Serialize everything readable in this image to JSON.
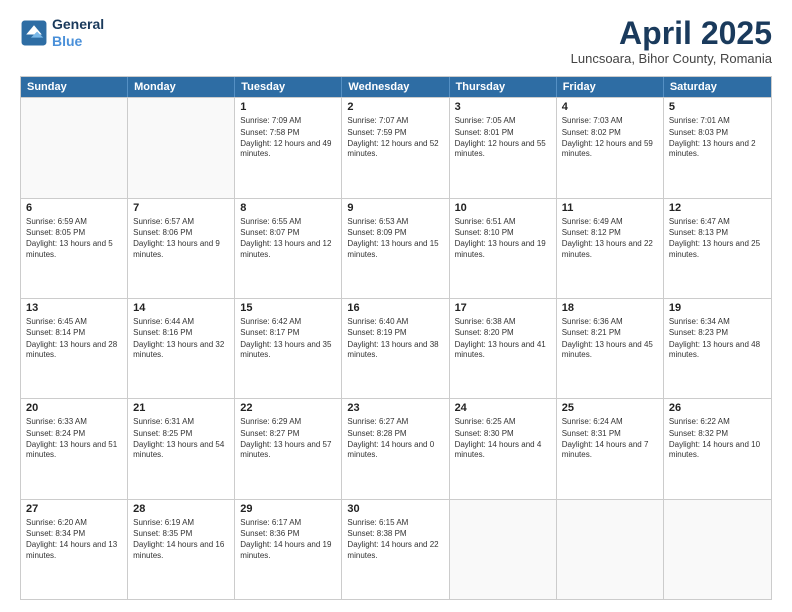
{
  "header": {
    "logo_line1": "General",
    "logo_line2": "Blue",
    "main_title": "April 2025",
    "subtitle": "Luncsoara, Bihor County, Romania"
  },
  "calendar": {
    "day_headers": [
      "Sunday",
      "Monday",
      "Tuesday",
      "Wednesday",
      "Thursday",
      "Friday",
      "Saturday"
    ],
    "rows": [
      [
        {
          "day": "",
          "sunrise": "",
          "sunset": "",
          "daylight": ""
        },
        {
          "day": "",
          "sunrise": "",
          "sunset": "",
          "daylight": ""
        },
        {
          "day": "1",
          "sunrise": "Sunrise: 7:09 AM",
          "sunset": "Sunset: 7:58 PM",
          "daylight": "Daylight: 12 hours and 49 minutes."
        },
        {
          "day": "2",
          "sunrise": "Sunrise: 7:07 AM",
          "sunset": "Sunset: 7:59 PM",
          "daylight": "Daylight: 12 hours and 52 minutes."
        },
        {
          "day": "3",
          "sunrise": "Sunrise: 7:05 AM",
          "sunset": "Sunset: 8:01 PM",
          "daylight": "Daylight: 12 hours and 55 minutes."
        },
        {
          "day": "4",
          "sunrise": "Sunrise: 7:03 AM",
          "sunset": "Sunset: 8:02 PM",
          "daylight": "Daylight: 12 hours and 59 minutes."
        },
        {
          "day": "5",
          "sunrise": "Sunrise: 7:01 AM",
          "sunset": "Sunset: 8:03 PM",
          "daylight": "Daylight: 13 hours and 2 minutes."
        }
      ],
      [
        {
          "day": "6",
          "sunrise": "Sunrise: 6:59 AM",
          "sunset": "Sunset: 8:05 PM",
          "daylight": "Daylight: 13 hours and 5 minutes."
        },
        {
          "day": "7",
          "sunrise": "Sunrise: 6:57 AM",
          "sunset": "Sunset: 8:06 PM",
          "daylight": "Daylight: 13 hours and 9 minutes."
        },
        {
          "day": "8",
          "sunrise": "Sunrise: 6:55 AM",
          "sunset": "Sunset: 8:07 PM",
          "daylight": "Daylight: 13 hours and 12 minutes."
        },
        {
          "day": "9",
          "sunrise": "Sunrise: 6:53 AM",
          "sunset": "Sunset: 8:09 PM",
          "daylight": "Daylight: 13 hours and 15 minutes."
        },
        {
          "day": "10",
          "sunrise": "Sunrise: 6:51 AM",
          "sunset": "Sunset: 8:10 PM",
          "daylight": "Daylight: 13 hours and 19 minutes."
        },
        {
          "day": "11",
          "sunrise": "Sunrise: 6:49 AM",
          "sunset": "Sunset: 8:12 PM",
          "daylight": "Daylight: 13 hours and 22 minutes."
        },
        {
          "day": "12",
          "sunrise": "Sunrise: 6:47 AM",
          "sunset": "Sunset: 8:13 PM",
          "daylight": "Daylight: 13 hours and 25 minutes."
        }
      ],
      [
        {
          "day": "13",
          "sunrise": "Sunrise: 6:45 AM",
          "sunset": "Sunset: 8:14 PM",
          "daylight": "Daylight: 13 hours and 28 minutes."
        },
        {
          "day": "14",
          "sunrise": "Sunrise: 6:44 AM",
          "sunset": "Sunset: 8:16 PM",
          "daylight": "Daylight: 13 hours and 32 minutes."
        },
        {
          "day": "15",
          "sunrise": "Sunrise: 6:42 AM",
          "sunset": "Sunset: 8:17 PM",
          "daylight": "Daylight: 13 hours and 35 minutes."
        },
        {
          "day": "16",
          "sunrise": "Sunrise: 6:40 AM",
          "sunset": "Sunset: 8:19 PM",
          "daylight": "Daylight: 13 hours and 38 minutes."
        },
        {
          "day": "17",
          "sunrise": "Sunrise: 6:38 AM",
          "sunset": "Sunset: 8:20 PM",
          "daylight": "Daylight: 13 hours and 41 minutes."
        },
        {
          "day": "18",
          "sunrise": "Sunrise: 6:36 AM",
          "sunset": "Sunset: 8:21 PM",
          "daylight": "Daylight: 13 hours and 45 minutes."
        },
        {
          "day": "19",
          "sunrise": "Sunrise: 6:34 AM",
          "sunset": "Sunset: 8:23 PM",
          "daylight": "Daylight: 13 hours and 48 minutes."
        }
      ],
      [
        {
          "day": "20",
          "sunrise": "Sunrise: 6:33 AM",
          "sunset": "Sunset: 8:24 PM",
          "daylight": "Daylight: 13 hours and 51 minutes."
        },
        {
          "day": "21",
          "sunrise": "Sunrise: 6:31 AM",
          "sunset": "Sunset: 8:25 PM",
          "daylight": "Daylight: 13 hours and 54 minutes."
        },
        {
          "day": "22",
          "sunrise": "Sunrise: 6:29 AM",
          "sunset": "Sunset: 8:27 PM",
          "daylight": "Daylight: 13 hours and 57 minutes."
        },
        {
          "day": "23",
          "sunrise": "Sunrise: 6:27 AM",
          "sunset": "Sunset: 8:28 PM",
          "daylight": "Daylight: 14 hours and 0 minutes."
        },
        {
          "day": "24",
          "sunrise": "Sunrise: 6:25 AM",
          "sunset": "Sunset: 8:30 PM",
          "daylight": "Daylight: 14 hours and 4 minutes."
        },
        {
          "day": "25",
          "sunrise": "Sunrise: 6:24 AM",
          "sunset": "Sunset: 8:31 PM",
          "daylight": "Daylight: 14 hours and 7 minutes."
        },
        {
          "day": "26",
          "sunrise": "Sunrise: 6:22 AM",
          "sunset": "Sunset: 8:32 PM",
          "daylight": "Daylight: 14 hours and 10 minutes."
        }
      ],
      [
        {
          "day": "27",
          "sunrise": "Sunrise: 6:20 AM",
          "sunset": "Sunset: 8:34 PM",
          "daylight": "Daylight: 14 hours and 13 minutes."
        },
        {
          "day": "28",
          "sunrise": "Sunrise: 6:19 AM",
          "sunset": "Sunset: 8:35 PM",
          "daylight": "Daylight: 14 hours and 16 minutes."
        },
        {
          "day": "29",
          "sunrise": "Sunrise: 6:17 AM",
          "sunset": "Sunset: 8:36 PM",
          "daylight": "Daylight: 14 hours and 19 minutes."
        },
        {
          "day": "30",
          "sunrise": "Sunrise: 6:15 AM",
          "sunset": "Sunset: 8:38 PM",
          "daylight": "Daylight: 14 hours and 22 minutes."
        },
        {
          "day": "",
          "sunrise": "",
          "sunset": "",
          "daylight": ""
        },
        {
          "day": "",
          "sunrise": "",
          "sunset": "",
          "daylight": ""
        },
        {
          "day": "",
          "sunrise": "",
          "sunset": "",
          "daylight": ""
        }
      ]
    ]
  }
}
